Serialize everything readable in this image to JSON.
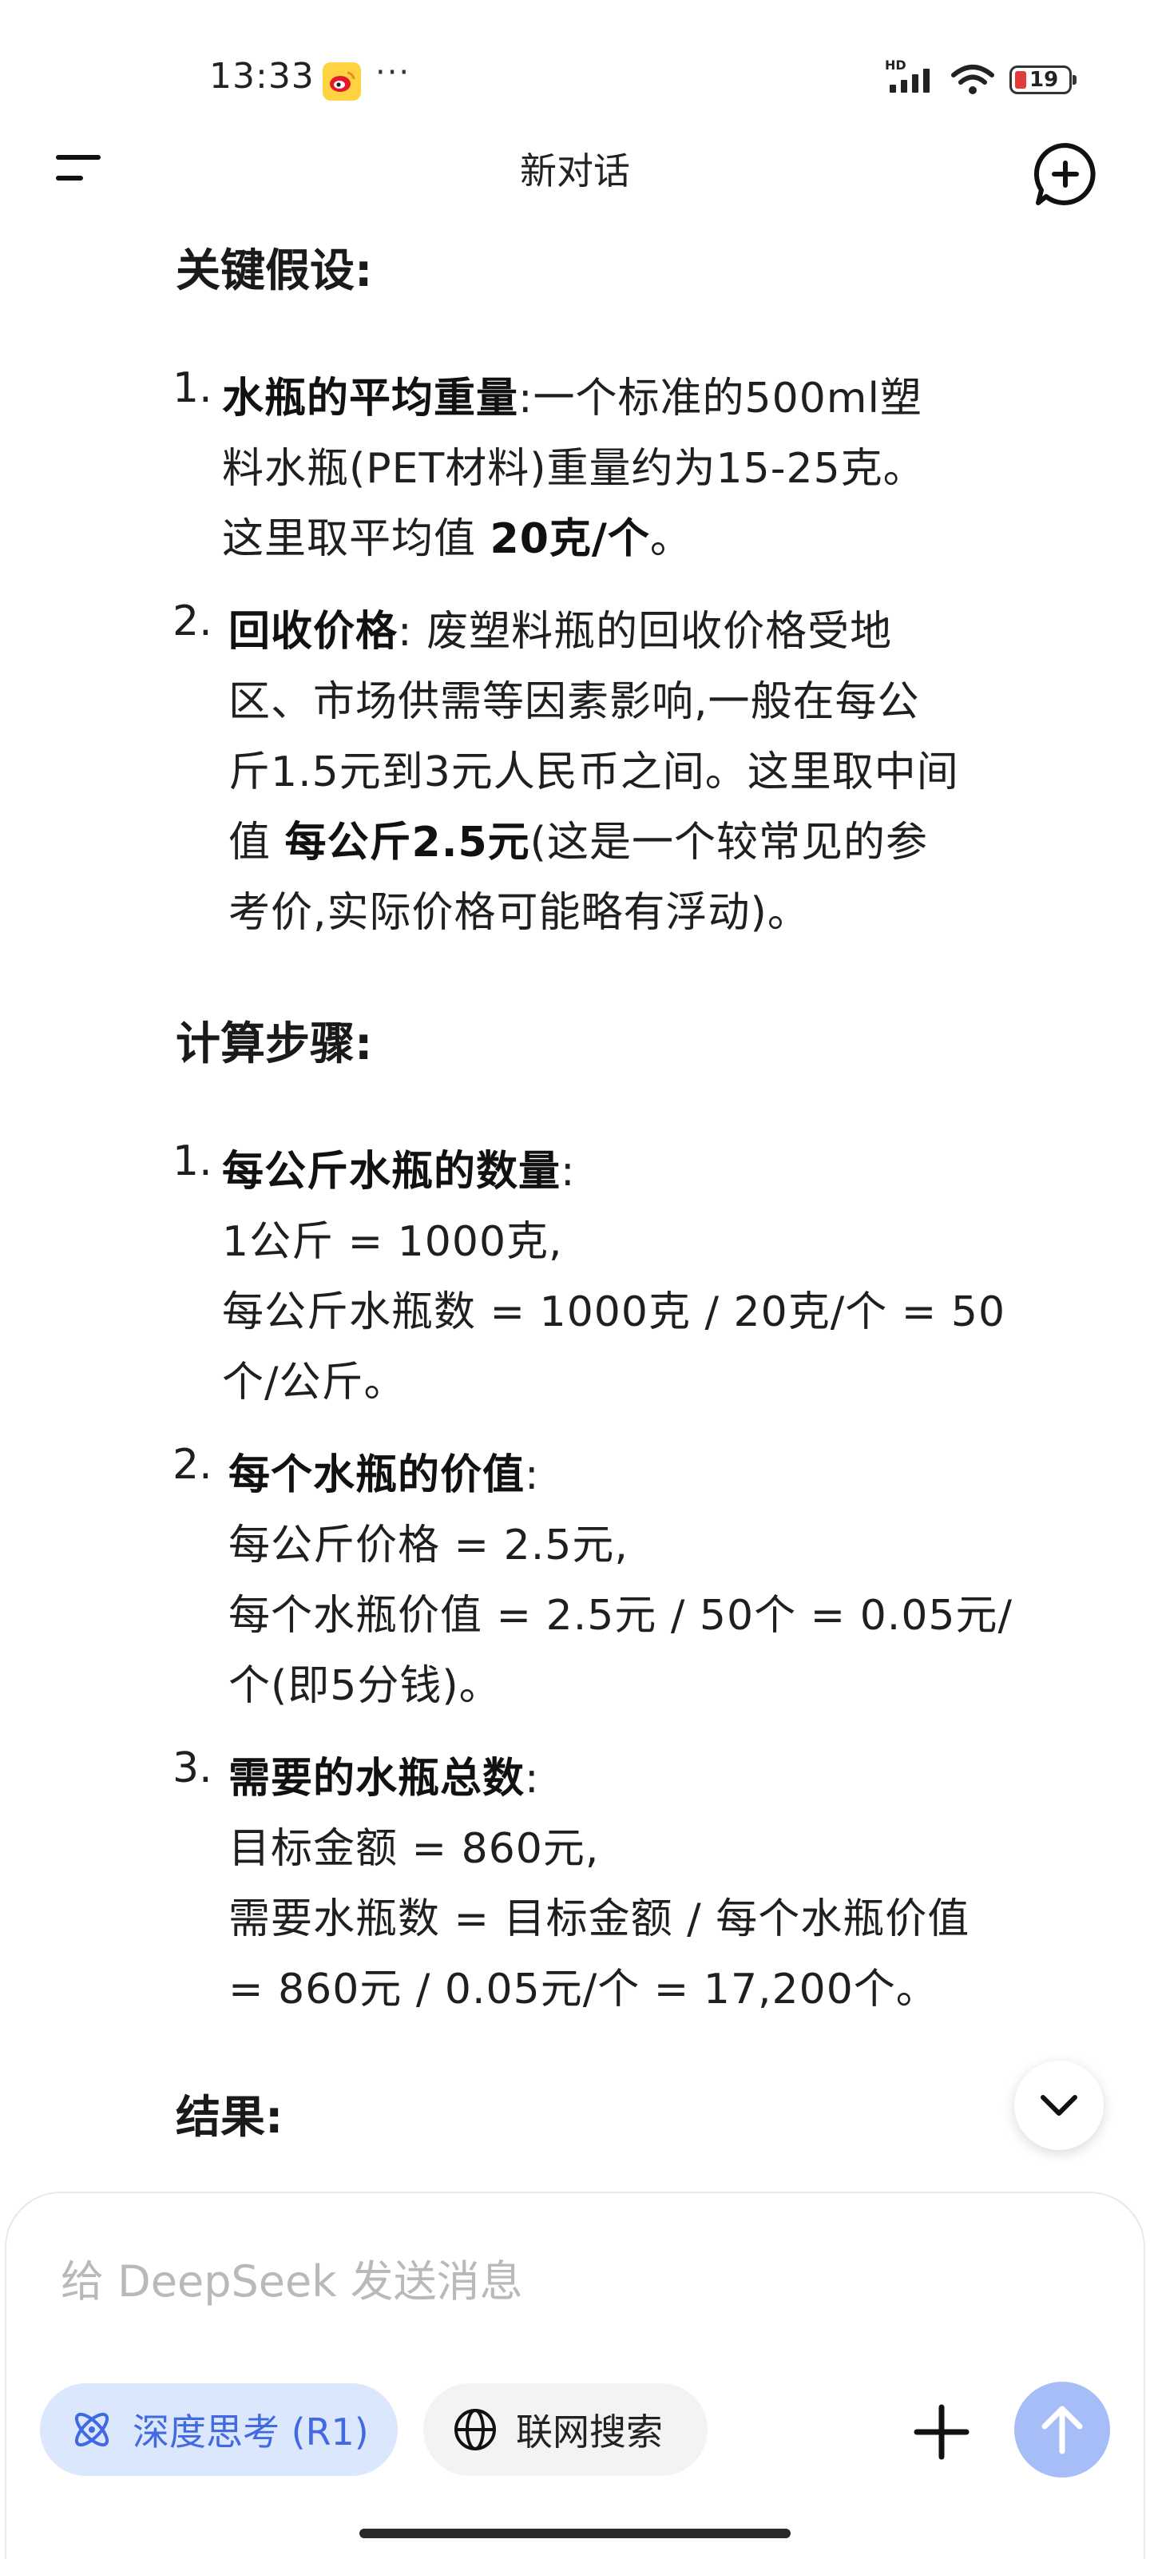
{
  "status_bar": {
    "time": "13:33",
    "more": "···",
    "network": "HD",
    "battery": "19"
  },
  "header": {
    "title": "新对话"
  },
  "sections": {
    "assumptions_title": "关键假设:",
    "steps_title": "计算步骤:",
    "result_title": "结果:"
  },
  "assumptions": [
    {
      "num": "1.",
      "lines": [
        {
          "bold": "水瓶的平均重量",
          "text": ":一个标准的500ml塑"
        },
        {
          "text": "料水瓶(PET材料)重量约为15-25克。"
        },
        {
          "text": "这里取平均值 ",
          "bold2": "20克/个",
          "text2": "。"
        }
      ]
    },
    {
      "num": "2.",
      "lines": [
        {
          "bold": "回收价格",
          "text": ": 废塑料瓶的回收价格受地"
        },
        {
          "text": "区、市场供需等因素影响,一般在每公"
        },
        {
          "text": "斤1.5元到3元人民币之间。这里取中间"
        },
        {
          "text": "值 ",
          "bold2": "每公斤2.5元",
          "text2": "(这是一个较常见的参"
        },
        {
          "text": "考价,实际价格可能略有浮动)。"
        }
      ]
    }
  ],
  "steps": [
    {
      "num": "1.",
      "lines": [
        {
          "bold": "每公斤水瓶的数量",
          "text": ":"
        },
        {
          "text": "1公斤 = 1000克,"
        },
        {
          "text": "每公斤水瓶数 = 1000克 / 20克/个 = 50"
        },
        {
          "text": "个/公斤。"
        }
      ]
    },
    {
      "num": "2.",
      "lines": [
        {
          "bold": "每个水瓶的价值",
          "text": ":"
        },
        {
          "text": "每公斤价格 = 2.5元,"
        },
        {
          "text": "每个水瓶价值 = 2.5元 / 50个 = 0.05元/"
        },
        {
          "text": "个(即5分钱)。"
        }
      ]
    },
    {
      "num": "3.",
      "lines": [
        {
          "bold": "需要的水瓶总数",
          "text": ":"
        },
        {
          "text": "目标金额 = 860元,"
        },
        {
          "text": "需要水瓶数 = 目标金额 / 每个水瓶价值"
        },
        {
          "text": "= 860元 / 0.05元/个 = 17,200个。"
        }
      ]
    }
  ],
  "input": {
    "placeholder": "给 DeepSeek 发送消息",
    "deep_think_label": "深度思考 (R1)",
    "web_search_label": "联网搜索"
  },
  "colors": {
    "accent": "#4169e1",
    "deep_chip_bg": "#dbe7fd",
    "send_bg": "#a7bdf7",
    "battery_low": "#e23b3b"
  }
}
